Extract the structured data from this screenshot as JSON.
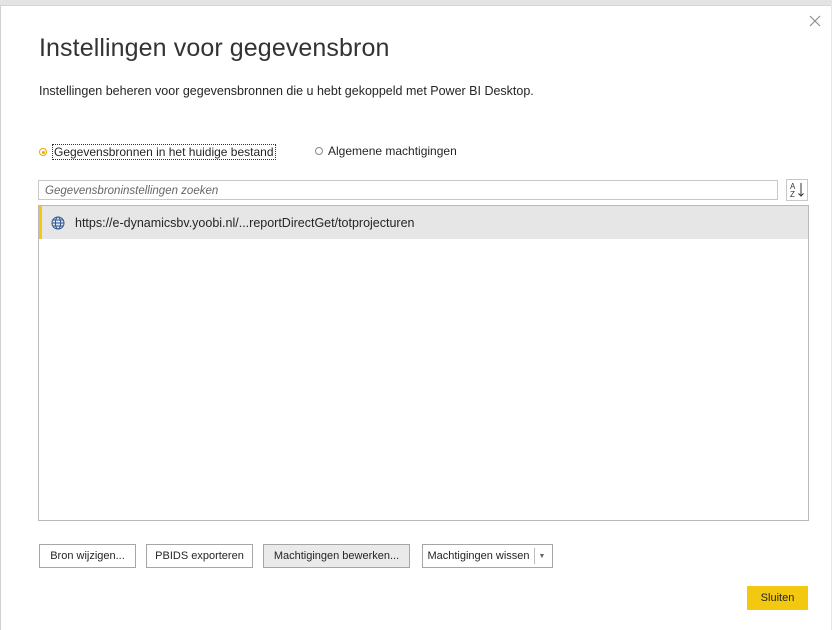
{
  "dialog": {
    "title": "Instellingen voor gegevensbron",
    "subtitle": "Instellingen beheren voor gegevensbronnen die u hebt gekoppeld met Power BI Desktop."
  },
  "scope": {
    "option_current_file": "Gegevensbronnen in het huidige bestand",
    "option_global": "Algemene machtigingen",
    "selected": "current_file"
  },
  "search": {
    "placeholder": "Gegevensbroninstellingen zoeken",
    "value": ""
  },
  "sort": {
    "icon": "sort-az-icon"
  },
  "sources": [
    {
      "url": "https://e-dynamicsbv.yoobi.nl/...reportDirectGet/totprojecturen",
      "icon": "globe-icon"
    }
  ],
  "buttons": {
    "change_source": "Bron wijzigen...",
    "export_pbids": "PBIDS exporteren",
    "edit_permissions": "Machtigingen bewerken...",
    "clear_permissions": "Machtigingen wissen",
    "close": "Sluiten"
  },
  "colors": {
    "accent": "#f2c811",
    "radio_selected": "#e8a900"
  }
}
